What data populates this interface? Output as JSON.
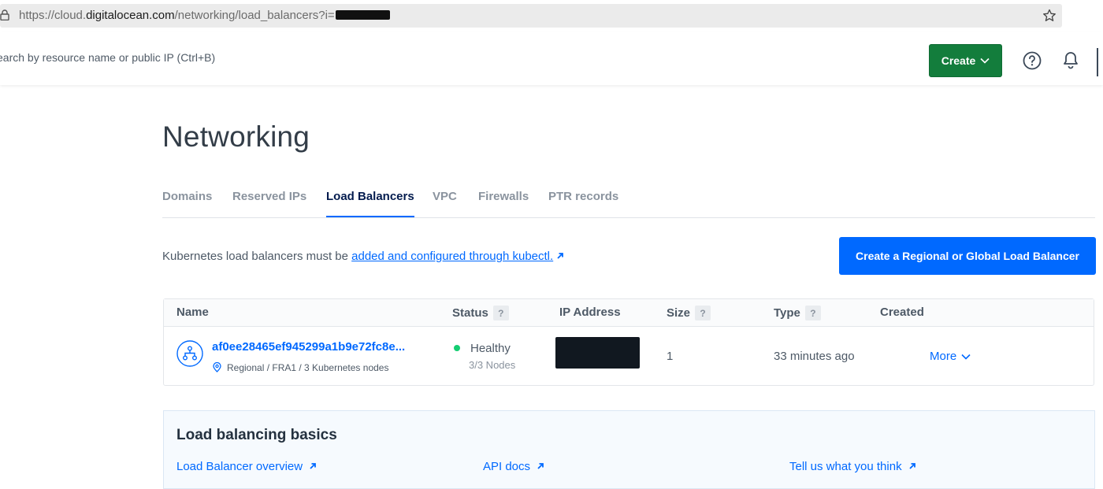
{
  "browser": {
    "url_prefix": "https://cloud.",
    "url_host": "digitalocean.com",
    "url_path": "/networking/load_balancers?i="
  },
  "topbar": {
    "search_placeholder": "earch by resource name or public IP (Ctrl+B)",
    "create_label": "Create"
  },
  "page": {
    "title": "Networking",
    "tabs": [
      {
        "label": "Domains",
        "active": false
      },
      {
        "label": "Reserved IPs",
        "active": false
      },
      {
        "label": "Load Balancers",
        "active": true
      },
      {
        "label": "VPC",
        "active": false
      },
      {
        "label": "Firewalls",
        "active": false
      },
      {
        "label": "PTR records",
        "active": false
      }
    ],
    "k8s_note_prefix": "Kubernetes load balancers must be ",
    "k8s_note_link": "added and configured through kubectl.",
    "create_lb_label": "Create a Regional or Global Load Balancer"
  },
  "table": {
    "columns": {
      "name": "Name",
      "status": "Status",
      "ip": "IP Address",
      "size": "Size",
      "type": "Type",
      "created": "Created"
    },
    "help_badge": "?",
    "rows": [
      {
        "name": "af0ee28465ef945299a1b9e72fc8e...",
        "region": "Regional / FRA1 / 3 Kubernetes nodes",
        "status": "Healthy",
        "nodes": "3/3 Nodes",
        "size": "1",
        "created": "33 minutes ago",
        "more": "More"
      }
    ]
  },
  "basics": {
    "title": "Load balancing basics",
    "links": [
      "Load Balancer overview",
      "API docs",
      "Tell us what you think"
    ]
  },
  "colors": {
    "accent_blue": "#0069ff",
    "create_green": "#137d3c",
    "healthy_green": "#15cd72"
  }
}
